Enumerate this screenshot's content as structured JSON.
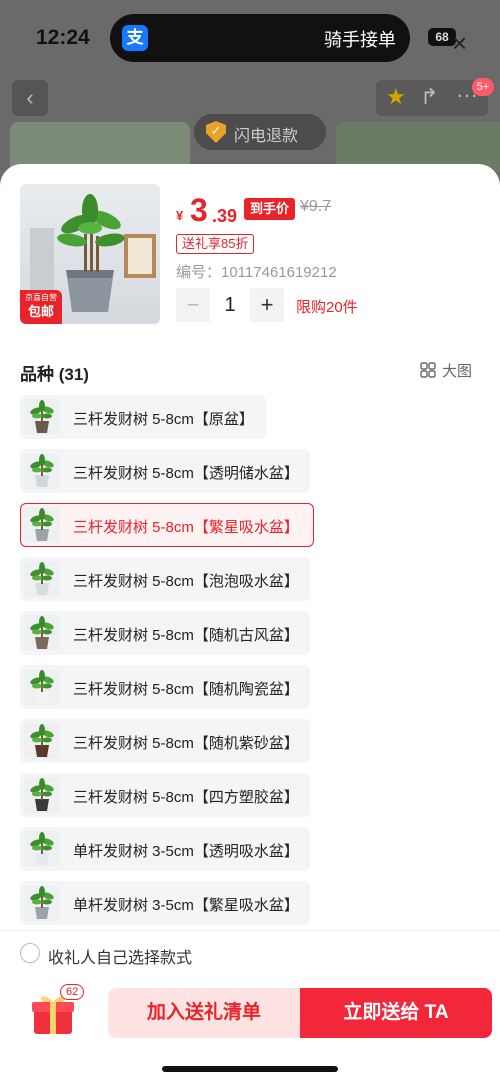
{
  "status_bar": {
    "time": "12:24",
    "app_icon": "支",
    "live_activity": "骑手接单",
    "battery": "68"
  },
  "background": {
    "cart_badge": "5+",
    "flash_refund": "闪电退款"
  },
  "product": {
    "thumb_badge_small": "京喜自营",
    "thumb_badge_main": "包邮",
    "currency": "¥",
    "price_int": "3",
    "price_dec": ".39",
    "deal_tag": "到手价",
    "orig_price": "¥9.7",
    "gift_discount": "送礼享85折",
    "sku": "编号：10117461619212",
    "quantity": "1",
    "limit": "限购20件"
  },
  "variety": {
    "title": "品种 (31)",
    "big_pic": "大图",
    "options": [
      {
        "label": "三杆发财树 5-8cm【原盆】",
        "selected": false,
        "pot": "#6b5a4a"
      },
      {
        "label": "三杆发财树 5-8cm【透明储水盆】",
        "selected": false,
        "pot": "#cfd8dc"
      },
      {
        "label": "三杆发财树 5-8cm【繁星吸水盆】",
        "selected": true,
        "pot": "#9aa3ab"
      },
      {
        "label": "三杆发财树 5-8cm【泡泡吸水盆】",
        "selected": false,
        "pot": "#d7dde2"
      },
      {
        "label": "三杆发财树 5-8cm【随机古风盆】",
        "selected": false,
        "pot": "#7b6a5a"
      },
      {
        "label": "三杆发财树 5-8cm【随机陶瓷盆】",
        "selected": false,
        "pot": "#f2f2f2"
      },
      {
        "label": "三杆发财树 5-8cm【随机紫砂盆】",
        "selected": false,
        "pot": "#5a3a2a"
      },
      {
        "label": "三杆发财树 5-8cm【四方塑胶盆】",
        "selected": false,
        "pot": "#3a3a3a"
      },
      {
        "label": "单杆发财树 3-5cm【透明吸水盆】",
        "selected": false,
        "pot": "#e4eaee"
      },
      {
        "label": "单杆发财树 3-5cm【繁星吸水盆】",
        "selected": false,
        "pot": "#9aa3ab"
      }
    ]
  },
  "recipient_choice": "收礼人自己选择款式",
  "footer": {
    "gift_count": "62",
    "add_list": "加入送礼清单",
    "send_now": "立即送给 TA"
  },
  "colors": {
    "accent": "#e8232a",
    "send_button": "#f2283a",
    "list_button_bg": "#ffe3e3"
  }
}
